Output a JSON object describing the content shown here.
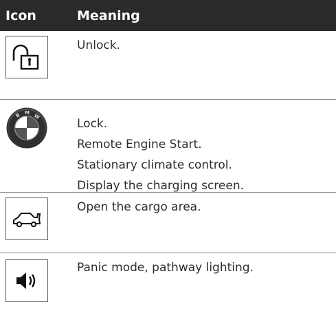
{
  "table": {
    "header": {
      "icon": "Icon",
      "meaning": "Meaning"
    },
    "rows": [
      {
        "icon": "unlock-icon",
        "lines": [
          "Unlock."
        ]
      },
      {
        "icon": "bmw-logo-icon",
        "lines": [
          "Lock.",
          "Remote Engine Start.",
          "Stationary climate control.",
          "Display the charging screen."
        ]
      },
      {
        "icon": "car-trunk-icon",
        "lines": [
          "Open the cargo area."
        ]
      },
      {
        "icon": "speaker-icon",
        "lines": [
          "Panic mode, pathway lighting."
        ]
      }
    ]
  },
  "colors": {
    "header_background": "#2a2a2a",
    "header_text": "#ffffff",
    "divider": "#8f8f8f"
  }
}
